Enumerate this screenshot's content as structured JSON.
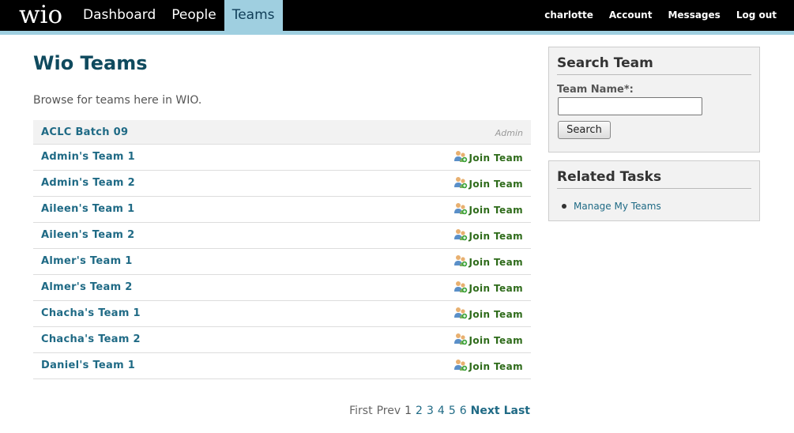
{
  "header": {
    "logo": "wio",
    "nav": [
      {
        "label": "Dashboard",
        "active": false
      },
      {
        "label": "People",
        "active": false
      },
      {
        "label": "Teams",
        "active": true
      }
    ],
    "user_nav": [
      "charlotte",
      "Account",
      "Messages",
      "Log out"
    ],
    "bar_color": "#000000",
    "accent_color": "#9fcfe0"
  },
  "main": {
    "title": "Wio Teams",
    "intro": "Browse for teams here in WIO.",
    "teams": [
      {
        "name": "ACLC Batch 09",
        "tag": "Admin"
      },
      {
        "name": "Admin's Team 1",
        "action": "Join Team"
      },
      {
        "name": "Admin's Team 2",
        "action": "Join Team"
      },
      {
        "name": "Aileen's Team 1",
        "action": "Join Team"
      },
      {
        "name": "Aileen's Team 2",
        "action": "Join Team"
      },
      {
        "name": "Almer's Team 1",
        "action": "Join Team"
      },
      {
        "name": "Almer's Team 2",
        "action": "Join Team"
      },
      {
        "name": "Chacha's Team 1",
        "action": "Join Team"
      },
      {
        "name": "Chacha's Team 2",
        "action": "Join Team"
      },
      {
        "name": "Daniel's Team 1",
        "action": "Join Team"
      }
    ],
    "pager": {
      "first": "First",
      "prev": "Prev",
      "current": "1",
      "pages": [
        "2",
        "3",
        "4",
        "5",
        "6"
      ],
      "next": "Next",
      "last": "Last"
    }
  },
  "sidebar": {
    "search": {
      "title": "Search Team",
      "label": "Team Name*:",
      "value": "",
      "button": "Search"
    },
    "tasks": {
      "title": "Related Tasks",
      "items": [
        "Manage My Teams"
      ]
    }
  }
}
